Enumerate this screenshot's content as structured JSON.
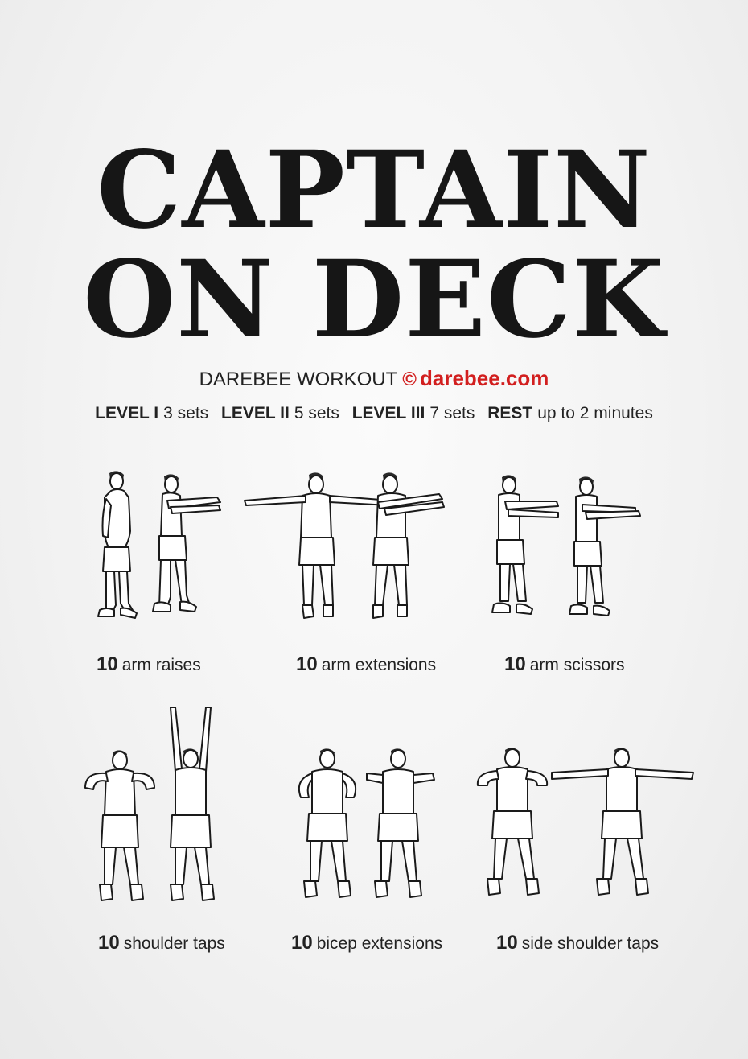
{
  "title": {
    "line1": "CAPTAIN",
    "line2": "ON DECK"
  },
  "byline": {
    "label": "DAREBEE WORKOUT",
    "copyright_symbol": "©",
    "site": "darebee.com",
    "site_color": "#d21f1f"
  },
  "levels": [
    {
      "label": "LEVEL I",
      "value": "3 sets"
    },
    {
      "label": "LEVEL II",
      "value": "5 sets"
    },
    {
      "label": "LEVEL III",
      "value": "7 sets"
    },
    {
      "label": "REST",
      "value": "up to 2 minutes"
    }
  ],
  "exercises": [
    {
      "reps": "10",
      "name": "arm raises"
    },
    {
      "reps": "10",
      "name": "arm extensions"
    },
    {
      "reps": "10",
      "name": "arm scissors"
    },
    {
      "reps": "10",
      "name": "shoulder taps"
    },
    {
      "reps": "10",
      "name": "bicep extensions"
    },
    {
      "reps": "10",
      "name": "side shoulder taps"
    }
  ]
}
